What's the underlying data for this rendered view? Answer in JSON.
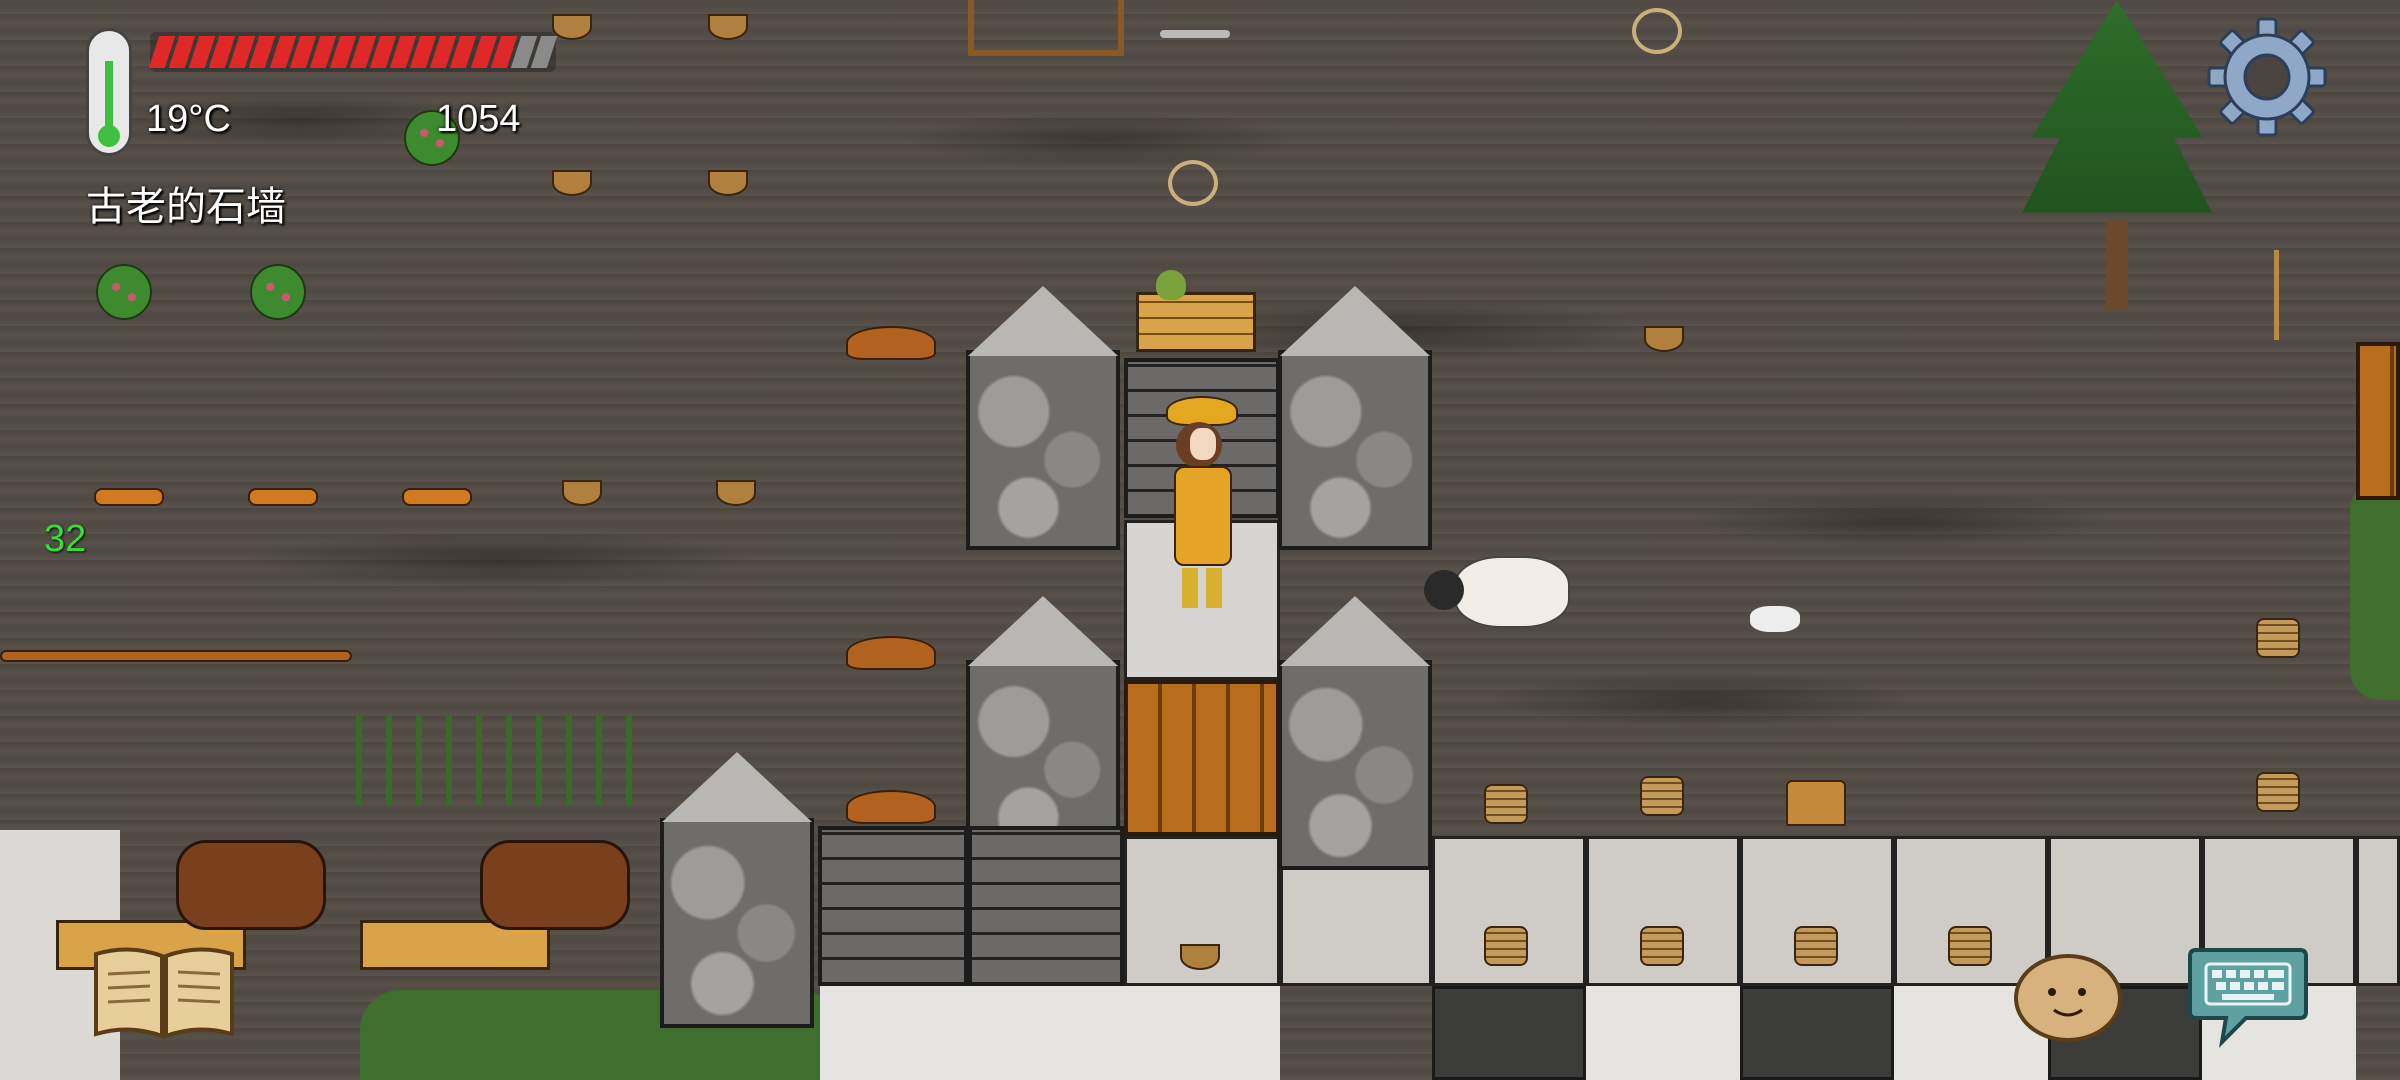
{
  "hud": {
    "temperature": "19°C",
    "count": "1054",
    "object_name": "古老的石墙",
    "age": "32",
    "health_segments_total": 20,
    "health_segments_filled": 18,
    "health_color": "#e02828",
    "health_empty_color": "#8a8a8a"
  },
  "icons": {
    "settings": "gear-icon",
    "book": "recipe-book-icon",
    "emote": "emote-face-icon",
    "keyboard": "keyboard-chat-icon"
  }
}
